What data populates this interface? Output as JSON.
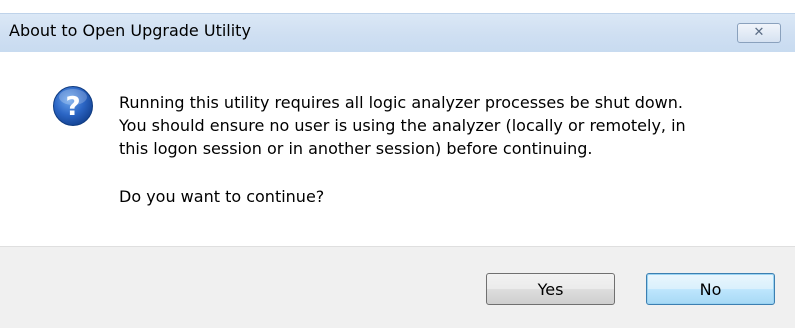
{
  "dialog": {
    "title": "About to Open Upgrade Utility",
    "close_label": "✕",
    "icon": "question-icon",
    "message_lines": [
      "Running this utility requires all logic analyzer processes be shut down.",
      "You should ensure no user is using the analyzer (locally or remotely, in",
      "this logon session or in another session) before continuing."
    ],
    "question": "Do you want to continue?",
    "buttons": {
      "yes_label": "Yes",
      "no_label": "No"
    }
  },
  "colors": {
    "titlebar": "#cfdff2",
    "footer": "#f0f0f0",
    "icon_blue": "#1e56b0",
    "focused_button_border": "#3c7fb1"
  }
}
